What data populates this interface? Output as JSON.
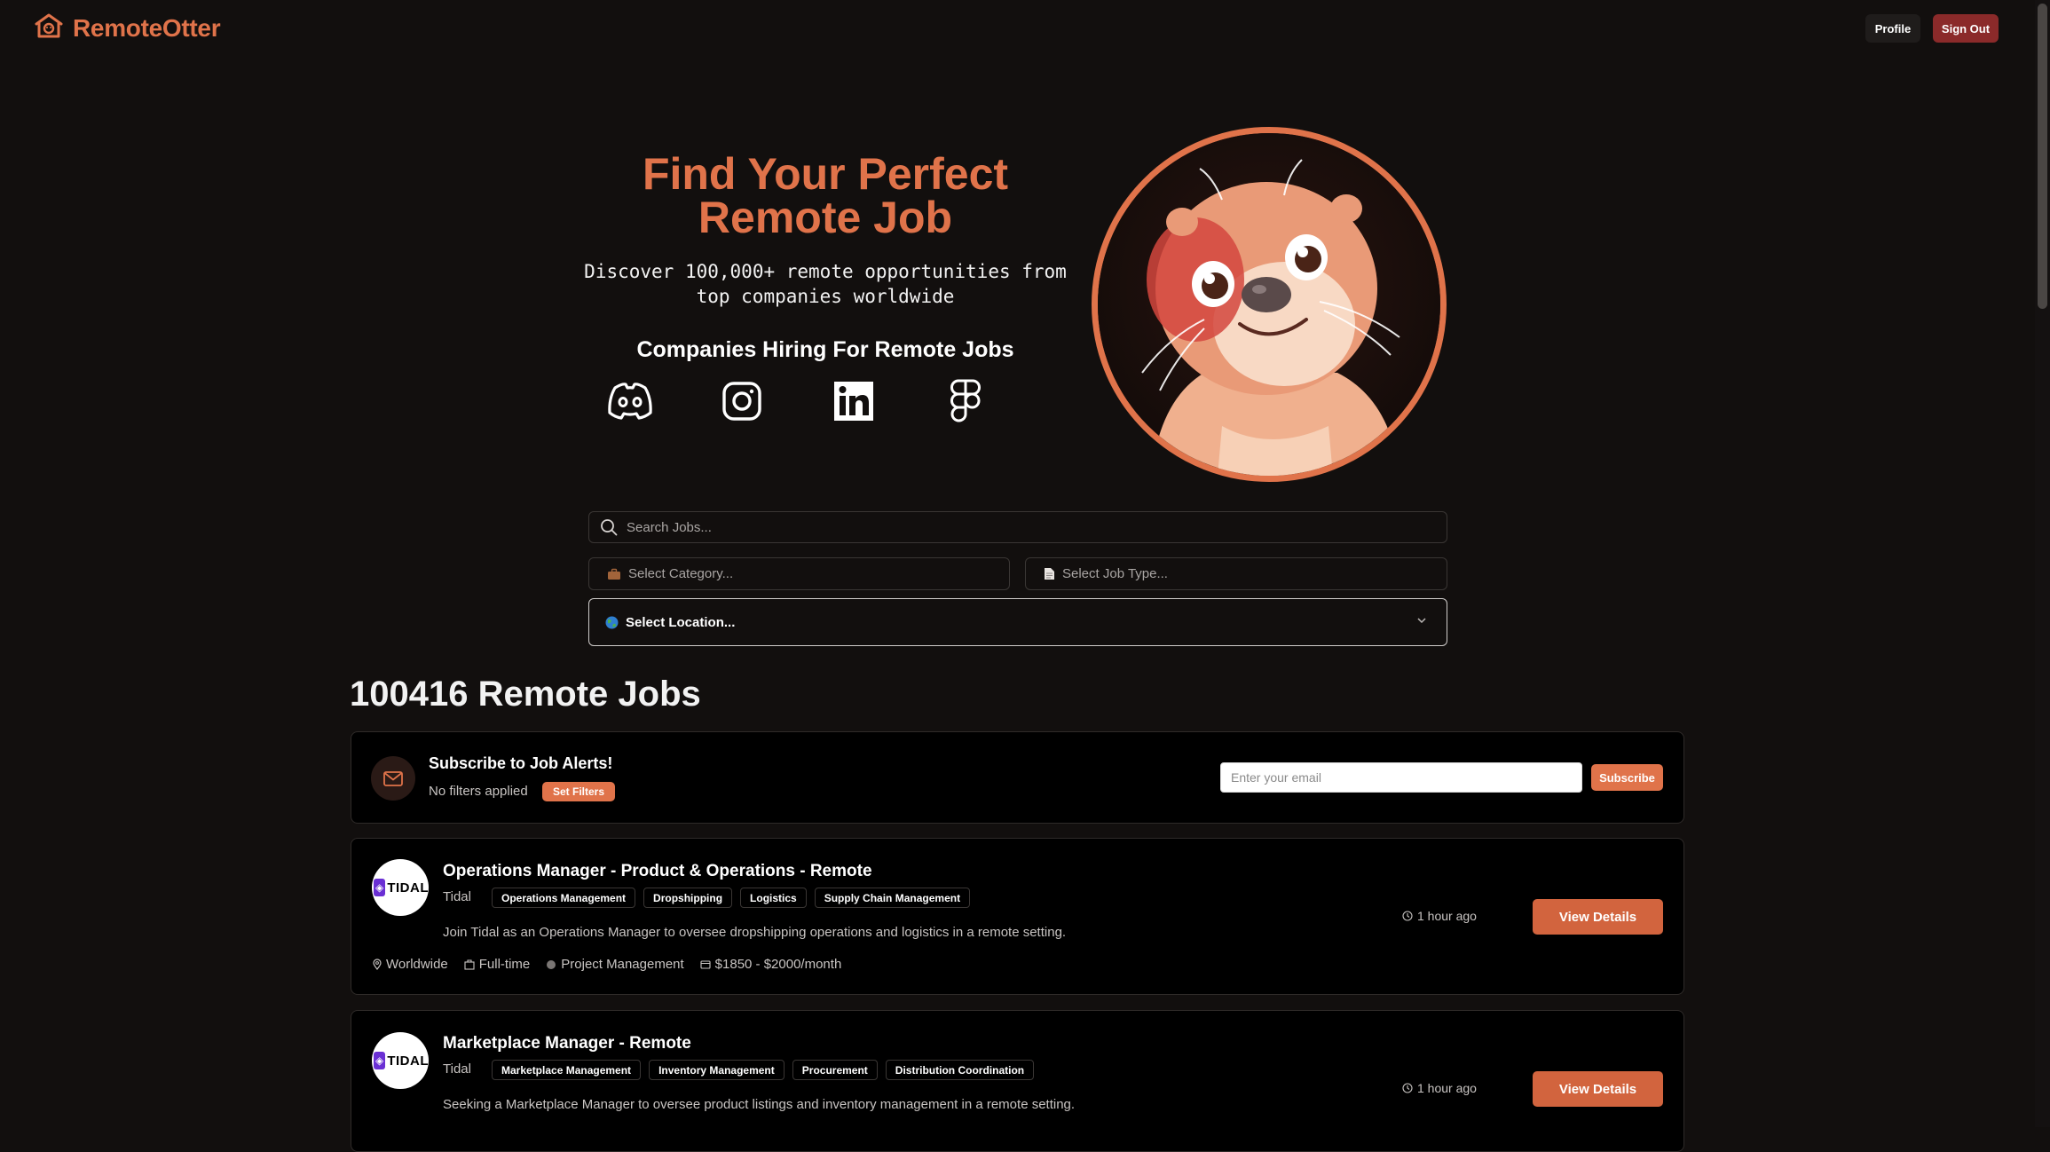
{
  "header": {
    "brand": "RemoteOtter",
    "profile_label": "Profile",
    "signout_label": "Sign Out"
  },
  "hero": {
    "title_line1": "Find Your Perfect",
    "title_line2": "Remote Job",
    "subtitle_line1": "Discover 100,000+ remote opportunities from",
    "subtitle_line2": "top companies worldwide",
    "companies_title": "Companies Hiring For Remote Jobs",
    "companies": [
      "discord-icon",
      "instagram-icon",
      "linkedin-icon",
      "figma-icon"
    ]
  },
  "search": {
    "placeholder": "Search Jobs...",
    "category_placeholder": "Select Category...",
    "job_type_placeholder": "Select Job Type...",
    "location_placeholder": "Select Location..."
  },
  "listing": {
    "count_text": "100416 Remote Jobs"
  },
  "alerts": {
    "title": "Subscribe to Job Alerts!",
    "no_filters": "No filters applied",
    "set_filters": "Set Filters",
    "email_placeholder": "Enter your email",
    "subscribe": "Subscribe"
  },
  "jobs": [
    {
      "title": "Operations Manager - Product & Operations - Remote",
      "company": "Tidal",
      "logo_text": "TIDAL",
      "tags": [
        "Operations Management",
        "Dropshipping",
        "Logistics",
        "Supply Chain Management"
      ],
      "description": "Join Tidal as an Operations Manager to oversee dropshipping operations and logistics in a remote setting.",
      "location": "Worldwide",
      "type": "Full-time",
      "category": "Project Management",
      "salary": "$1850 - $2000/month",
      "posted": "1 hour ago",
      "cta": "View Details"
    },
    {
      "title": "Marketplace Manager - Remote",
      "company": "Tidal",
      "logo_text": "TIDAL",
      "tags": [
        "Marketplace Management",
        "Inventory Management",
        "Procurement",
        "Distribution Coordination"
      ],
      "description": "Seeking a Marketplace Manager to oversee product listings and inventory management in a remote setting.",
      "posted": "1 hour ago",
      "cta": "View Details"
    }
  ],
  "colors": {
    "background": "#120f0e",
    "accent": "#e0734a",
    "signout": "#8b2a2a",
    "card": "#000000"
  }
}
